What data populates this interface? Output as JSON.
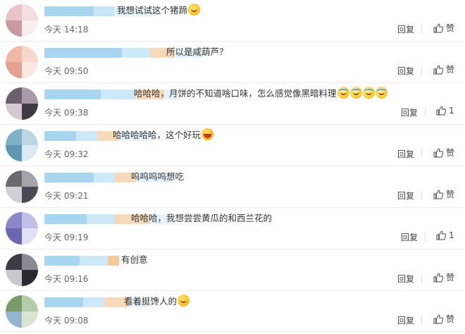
{
  "comments": [
    {
      "text": "我想试试这个猪蹄",
      "emoji": [
        "smile"
      ],
      "time": "今天 14:18",
      "reply": "回复",
      "like": "赞",
      "avatar_colors": [
        "#e8c4c8",
        "#f2dde0",
        "#c99aa0",
        "#f7eef0"
      ],
      "name_colors": [
        "#a8d6f0",
        "#c9e6f6",
        "#e6f2fa"
      ]
    },
    {
      "text": "所以是咸葫芦？",
      "emoji": [],
      "time": "今天 09:50",
      "reply": "回复",
      "like": "赞",
      "avatar_colors": [
        "#f0b8a8",
        "#f8d8cc",
        "#e4a090",
        "#fbe8e0"
      ],
      "name_colors": [
        "#a8d6f0",
        "#cde8f6",
        "#f5d9b8",
        "#e6f2fa"
      ]
    },
    {
      "text": "哈哈哈，月饼的不知道啥口味，怎么感觉像黑暗料理",
      "emoji": [
        "cry",
        "cry",
        "cry",
        "cry"
      ],
      "time": "今天 09:38",
      "reply": "回复",
      "like": "1",
      "avatar_colors": [
        "#6a5f6a",
        "#a89aa6",
        "#d4c8d2",
        "#3f3a44"
      ],
      "name_colors": [
        "#a8d6f0",
        "#cde8f6",
        "#f5d9b8",
        "#e6f2fa"
      ]
    },
    {
      "text": "哈哈哈哈哈，这个好玩",
      "emoji": [
        "laugh"
      ],
      "time": "今天 09:32",
      "reply": "回复",
      "like": "赞",
      "avatar_colors": [
        "#7fb0c8",
        "#bad6e4",
        "#5e96b4",
        "#dbeaf2"
      ],
      "name_colors": [
        "#a8d6f0",
        "#cde8f6",
        "#f5d9b8",
        "#e6f2fa"
      ]
    },
    {
      "text": "呜呜呜呜想吃",
      "emoji": [],
      "time": "今天 09:21",
      "reply": "回复",
      "like": "赞",
      "avatar_colors": [
        "#6a6a70",
        "#a4a4aa",
        "#d0d0d6",
        "#4a4a52"
      ],
      "name_colors": [
        "#a8d6f0",
        "#cde8f6",
        "#f5d9b8",
        "#e6f2fa"
      ]
    },
    {
      "text": "哈哈哈，我想尝尝黄瓜的和西兰花的",
      "emoji": [],
      "time": "今天 09:19",
      "reply": "回复",
      "like": "1",
      "avatar_colors": [
        "#8a86c8",
        "#c0bde6",
        "#6c68b0",
        "#e2e0f4"
      ],
      "name_colors": [
        "#a8d6f0",
        "#cde8f6",
        "#f5d9b8",
        "#e6f2fa"
      ]
    },
    {
      "text": "有创意",
      "emoji": [],
      "time": "今天 09:16",
      "reply": "回复",
      "like": "赞",
      "avatar_colors": [
        "#3c3c44",
        "#8a8a92",
        "#c8c8ce",
        "#2a2a30"
      ],
      "name_colors": [
        "#a8d6f0",
        "#cde8f6",
        "#f5c89a",
        "#e6f2fa"
      ]
    },
    {
      "text": "看着挺馋人的",
      "emoji": [
        "smile"
      ],
      "time": "今天 09:08",
      "reply": "回复",
      "like": "赞",
      "avatar_colors": [
        "#7a9a6a",
        "#b4ccaa",
        "#94b4d0",
        "#d8e6d0"
      ],
      "name_colors": [
        "#a8d6f0",
        "#cde8f6",
        "#f5d9b8",
        "#e6f2fa"
      ]
    }
  ]
}
